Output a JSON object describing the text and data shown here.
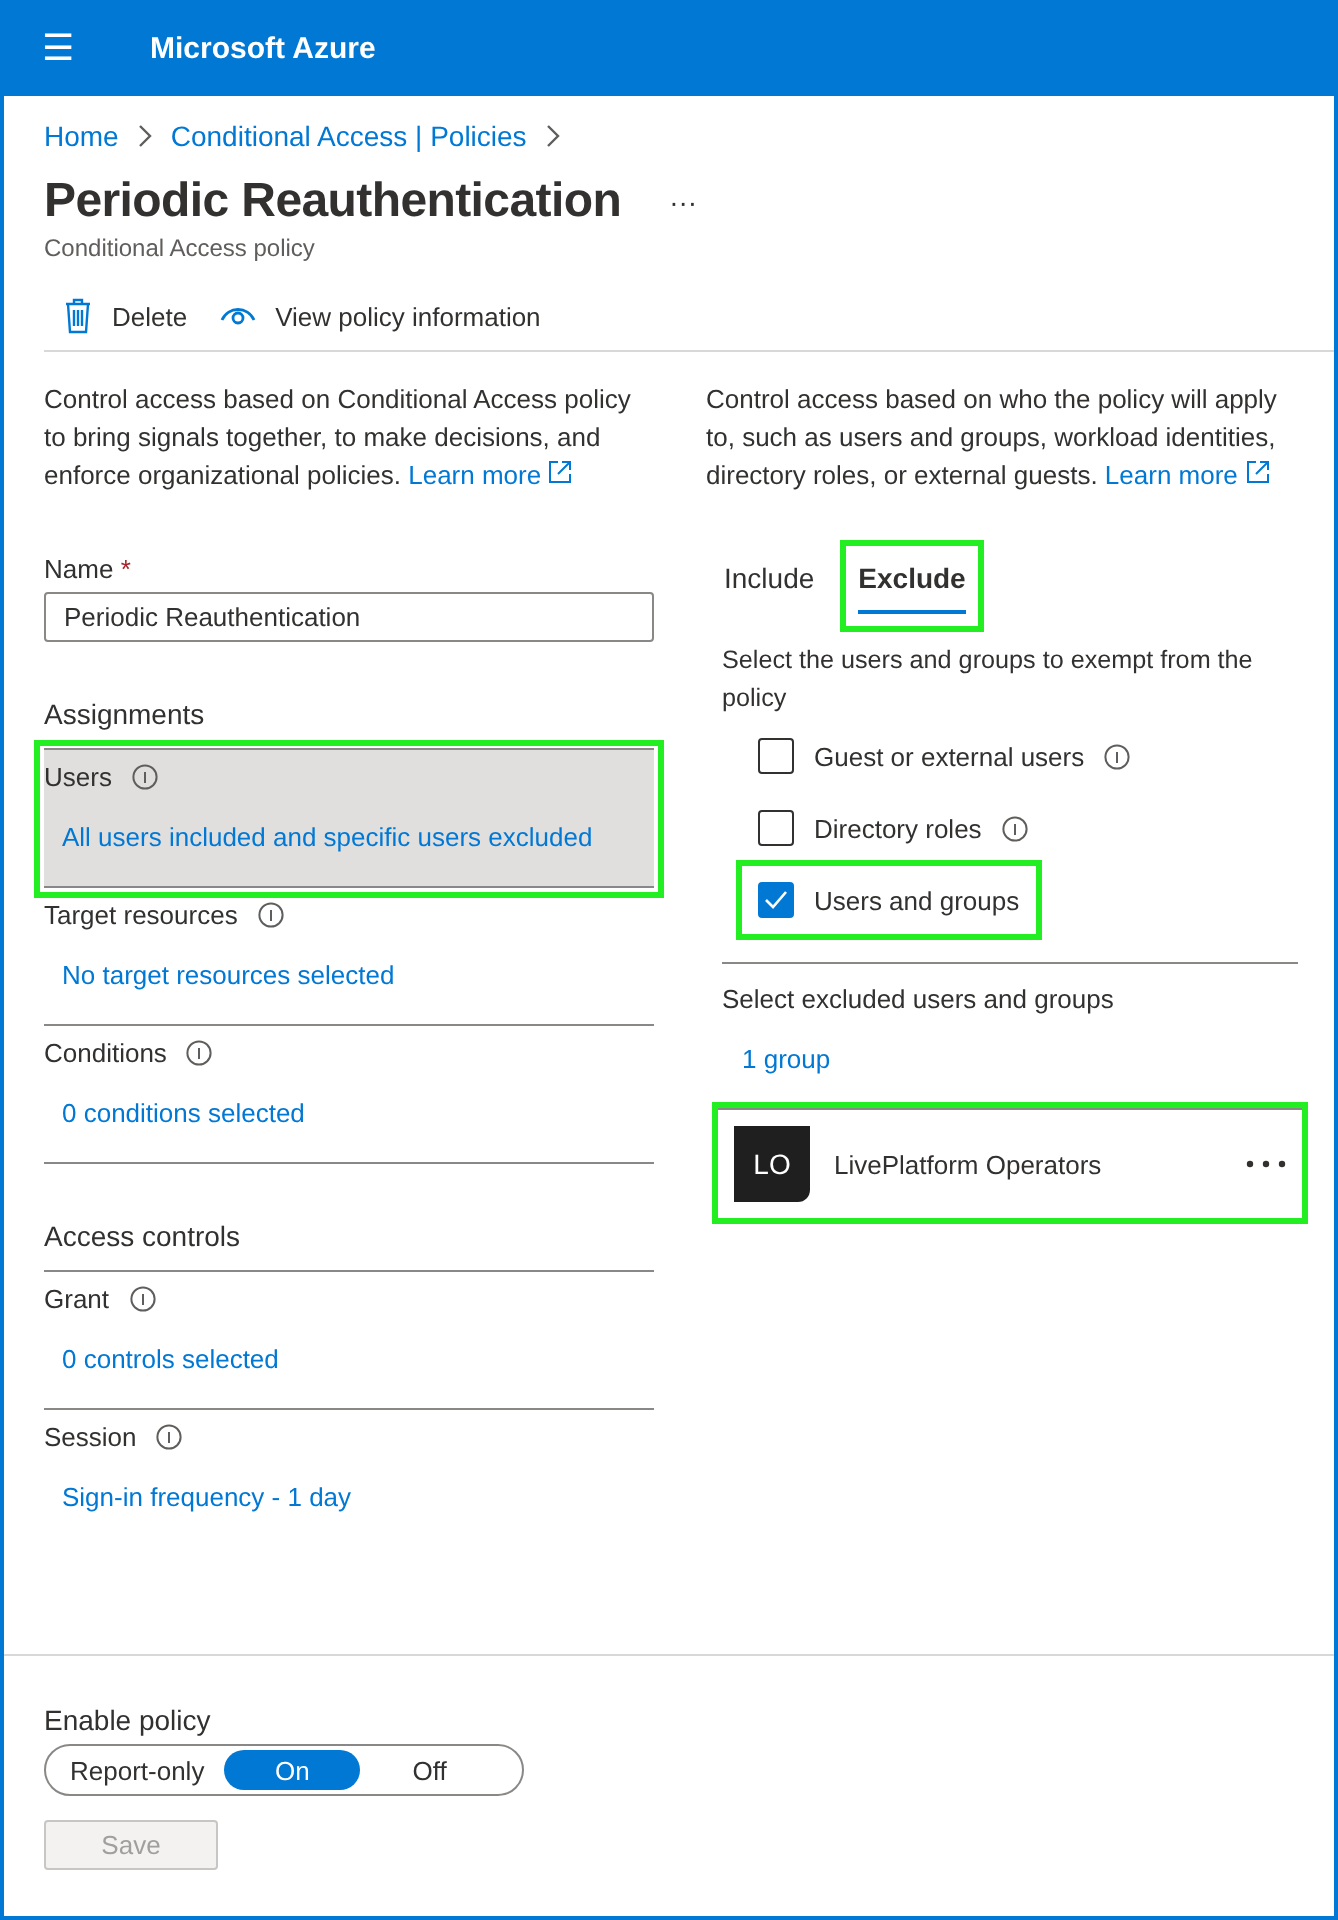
{
  "header": {
    "menu_icon": "☰",
    "title": "Microsoft Azure"
  },
  "breadcrumb": [
    "Home",
    "Conditional Access | Policies"
  ],
  "page": {
    "title": "Periodic Reauthentication",
    "more": "···",
    "subtitle": "Conditional Access policy"
  },
  "toolbar": [
    "Delete",
    "View policy information"
  ],
  "left": {
    "description": "Control access based on Conditional Access policy to bring signals together, to make decisions, and enforce organizational policies.",
    "learn_more": "Learn more",
    "name_label": "Name",
    "required_mark": "*",
    "name_value": "Periodic Reauthentication",
    "sections": [
      {
        "heading": "Assignments",
        "items": [
          {
            "label": "Users",
            "value": "All users included and specific users excluded",
            "selected": true,
            "highlighted": true
          },
          {
            "label": "Target resources",
            "value": "No target resources selected",
            "selected": false,
            "highlighted": false
          },
          {
            "label": "Conditions",
            "value": "0 conditions selected",
            "selected": false,
            "highlighted": false
          }
        ]
      },
      {
        "heading": "Access controls",
        "items": [
          {
            "label": "Grant",
            "value": "0 controls selected",
            "selected": false,
            "highlighted": false
          },
          {
            "label": "Session",
            "value": "Sign-in frequency - 1 day",
            "selected": false,
            "highlighted": false
          }
        ]
      }
    ]
  },
  "right": {
    "description": "Control access based on who the policy will apply to, such as users and groups, workload identities, directory roles, or external guests.",
    "learn_more": "Learn more",
    "tabs": [
      {
        "label": "Include",
        "selected": false,
        "highlighted": false
      },
      {
        "label": "Exclude",
        "selected": true,
        "highlighted": true
      }
    ],
    "prompt": "Select the users and groups to exempt from the policy",
    "options": [
      {
        "label": "Guest or external users",
        "checked": false,
        "info": true,
        "highlighted": false
      },
      {
        "label": "Directory roles",
        "checked": false,
        "info": true,
        "highlighted": false
      },
      {
        "label": "Users and groups",
        "checked": true,
        "info": false,
        "highlighted": true
      }
    ],
    "select_label": "Select excluded users and groups",
    "count_link": "1 group",
    "members": [
      {
        "initials": "LO",
        "name": "LivePlatform Operators",
        "highlighted": true
      }
    ]
  },
  "footer": {
    "label": "Enable policy",
    "toggle": [
      {
        "label": "Report-only",
        "selected": false
      },
      {
        "label": "On",
        "selected": true
      },
      {
        "label": "Off",
        "selected": false
      }
    ],
    "save": {
      "label": "Save",
      "disabled": true
    }
  }
}
